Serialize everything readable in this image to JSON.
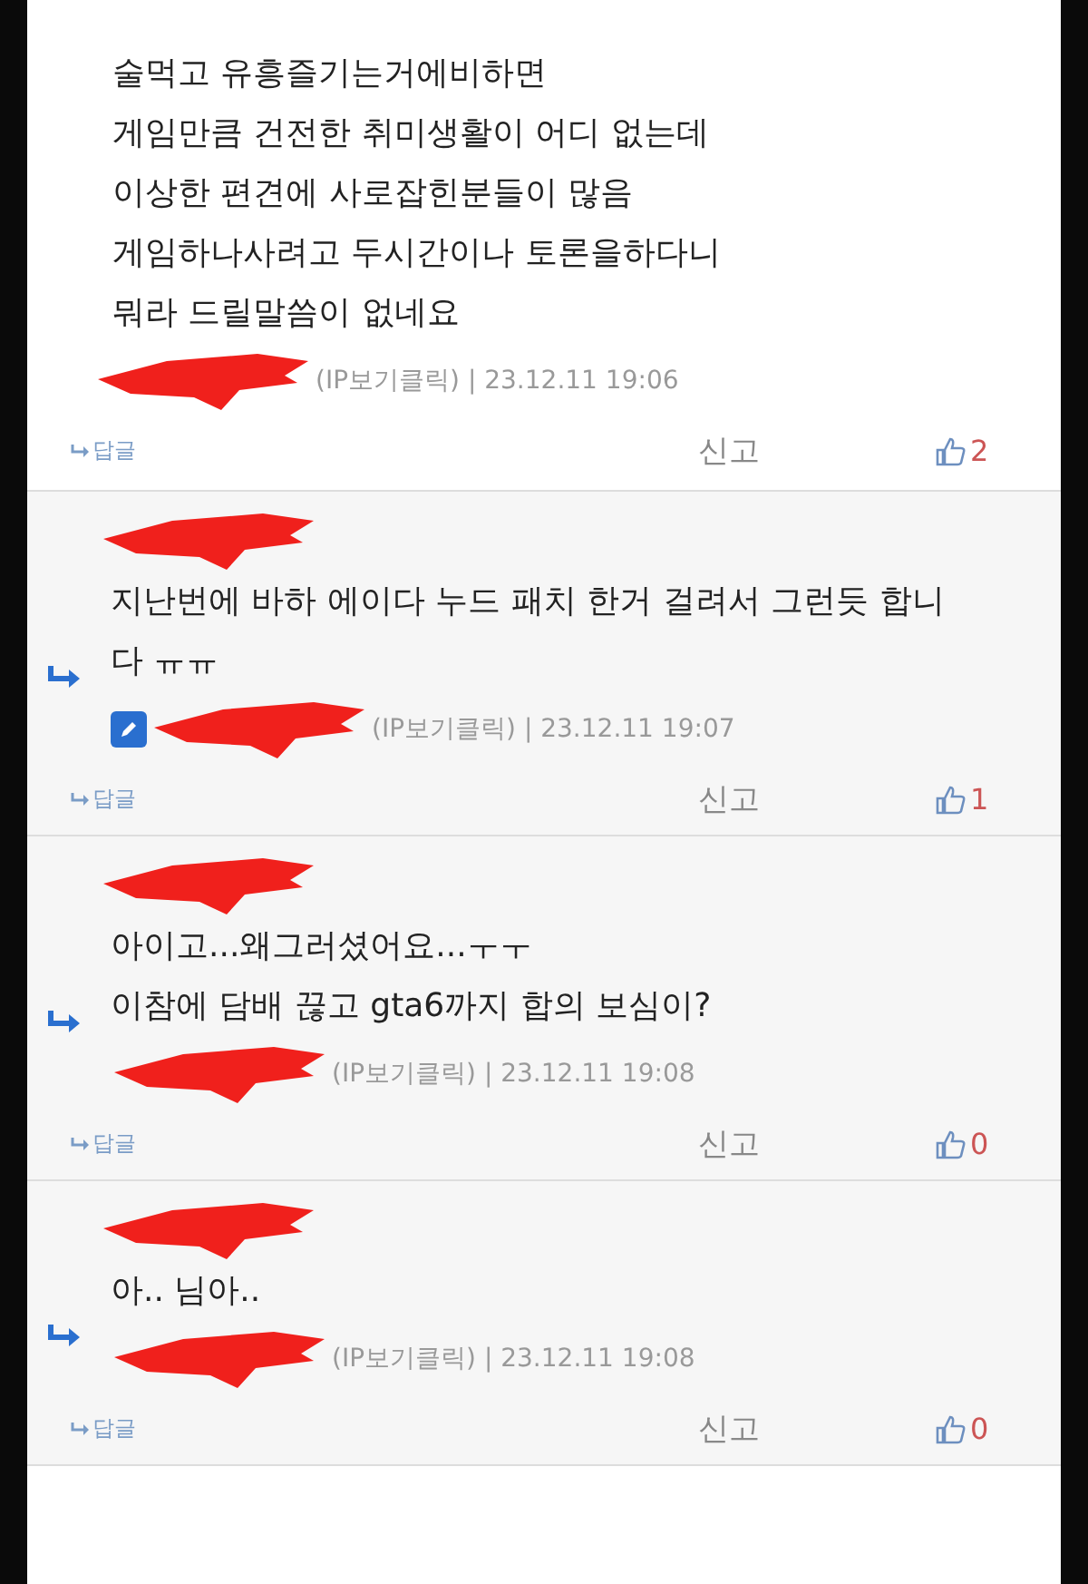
{
  "comments": [
    {
      "kind": "comment",
      "top_redaction": false,
      "text": "술먹고 유흥즐기는거에비하면\n게임만큼 건전한 취미생활이 어디 없는데\n이상한 편견에 사로잡힌분들이 많음\n게임하나사려고 두시간이나 토론을하다니\n뭐라 드릴말씀이 없네요",
      "edit_badge": false,
      "meta": "(IP보기클릭) | 23.12.11 19:06",
      "reply": "답글",
      "report": "신고",
      "likes": "2"
    },
    {
      "kind": "reply",
      "top_redaction": true,
      "text": "지난번에 바하 에이다 누드 패치 한거 걸려서 그런듯 합니다 ㅠㅠ",
      "edit_badge": true,
      "meta": "(IP보기클릭) | 23.12.11 19:07",
      "reply": "답글",
      "report": "신고",
      "likes": "1"
    },
    {
      "kind": "reply",
      "top_redaction": true,
      "text": "아이고...왜그러셨어요...ㅜㅜ\n이참에 담배 끊고 gta6까지 합의 보심이?",
      "edit_badge": false,
      "meta": "(IP보기클릭) | 23.12.11 19:08",
      "reply": "답글",
      "report": "신고",
      "likes": "0"
    },
    {
      "kind": "reply",
      "top_redaction": true,
      "text": "아.. 님아..",
      "edit_badge": false,
      "meta": "(IP보기클릭) | 23.12.11 19:08",
      "reply": "답글",
      "report": "신고",
      "likes": "0"
    }
  ]
}
